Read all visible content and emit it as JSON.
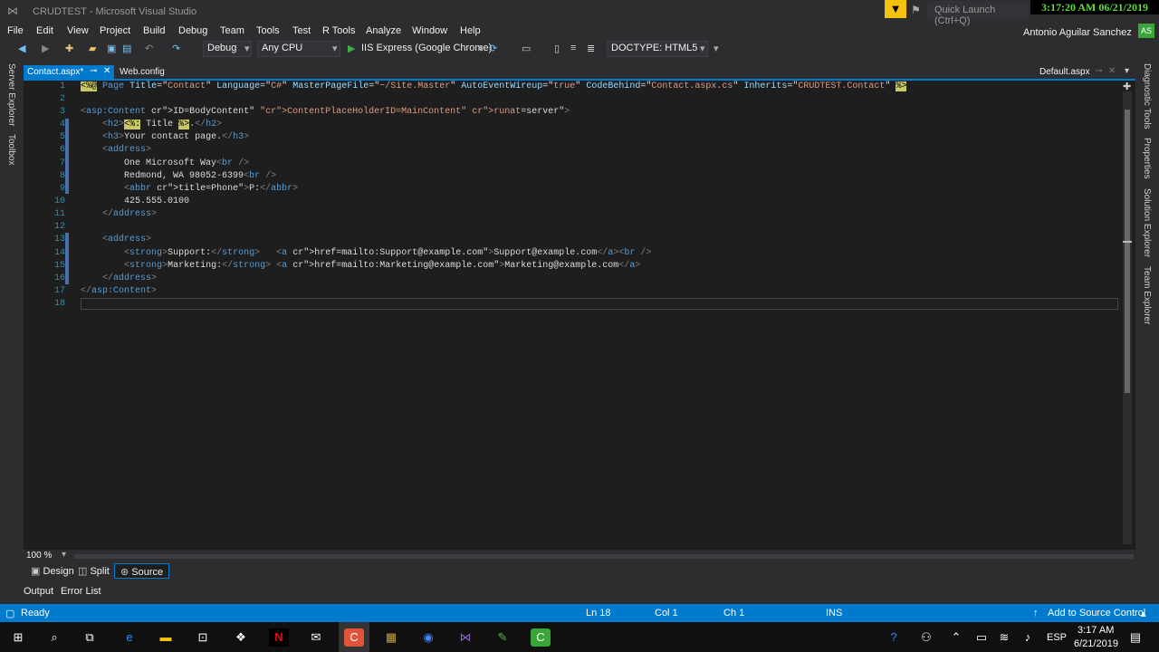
{
  "window": {
    "title": "CRUDTEST - Microsoft Visual Studio",
    "quick_launch_placeholder": "Quick Launch (Ctrl+Q)",
    "clock_overlay": "3:17:20 AM 06/21/2019",
    "user": "Antonio Aguilar Sanchez",
    "avatar": "AS"
  },
  "menu": [
    "File",
    "Edit",
    "View",
    "Project",
    "Build",
    "Debug",
    "Team",
    "Tools",
    "Test",
    "R Tools",
    "Analyze",
    "Window",
    "Help"
  ],
  "toolbar": {
    "config": "Debug",
    "platform": "Any CPU",
    "run_target": "IIS Express (Google Chrome)",
    "doctype": "DOCTYPE: HTML5"
  },
  "left_tabs": [
    "Server Explorer",
    "Toolbox"
  ],
  "right_tabs": [
    "Diagnostic Tools",
    "Properties",
    "Solution Explorer",
    "Team Explorer"
  ],
  "doc_tabs": {
    "active": "Contact.aspx*",
    "second": "Web.config",
    "right": "Default.aspx"
  },
  "code_lines": [
    {
      "n": "1",
      "t": "<%@ Page Title=\"Contact\" Language=\"C#\" MasterPageFile=\"~/Site.Master\" AutoEventWireup=\"true\" CodeBehind=\"Contact.aspx.cs\" Inherits=\"CRUDTEST.Contact\" %>"
    },
    {
      "n": "2",
      "t": ""
    },
    {
      "n": "3",
      "t": "<asp:Content ID=\"BodyContent\" ContentPlaceHolderID=\"MainContent\" runat=\"server\">"
    },
    {
      "n": "4",
      "t": "    <h2><%: Title %>.</h2>"
    },
    {
      "n": "5",
      "t": "    <h3>Your contact page.</h3>"
    },
    {
      "n": "6",
      "t": "    <address>"
    },
    {
      "n": "7",
      "t": "        One Microsoft Way<br />"
    },
    {
      "n": "8",
      "t": "        Redmond, WA 98052-6399<br />"
    },
    {
      "n": "9",
      "t": "        <abbr title=\"Phone\">P:</abbr>"
    },
    {
      "n": "10",
      "t": "        425.555.0100"
    },
    {
      "n": "11",
      "t": "    </address>"
    },
    {
      "n": "12",
      "t": ""
    },
    {
      "n": "13",
      "t": "    <address>"
    },
    {
      "n": "14",
      "t": "        <strong>Support:</strong>   <a href=\"mailto:Support@example.com\">Support@example.com</a><br />"
    },
    {
      "n": "15",
      "t": "        <strong>Marketing:</strong> <a href=\"mailto:Marketing@example.com\">Marketing@example.com</a>"
    },
    {
      "n": "16",
      "t": "    </address>"
    },
    {
      "n": "17",
      "t": "</asp:Content>"
    },
    {
      "n": "18",
      "t": ""
    }
  ],
  "zoom": "100 %",
  "view_tabs": [
    "Design",
    "Split",
    "Source"
  ],
  "output_tabs": [
    "Output",
    "Error List"
  ],
  "status": {
    "ready": "Ready",
    "ln": "Ln 18",
    "col": "Col 1",
    "ch": "Ch 1",
    "ins": "INS",
    "source_control": "Add to Source Control"
  },
  "taskbar": {
    "lang": "ESP",
    "time": "3:17 AM",
    "date": "6/21/2019"
  },
  "colors": {
    "accent": "#007acc",
    "editor_bg": "#1e1e1e",
    "chrome_bg": "#2d2d30"
  }
}
